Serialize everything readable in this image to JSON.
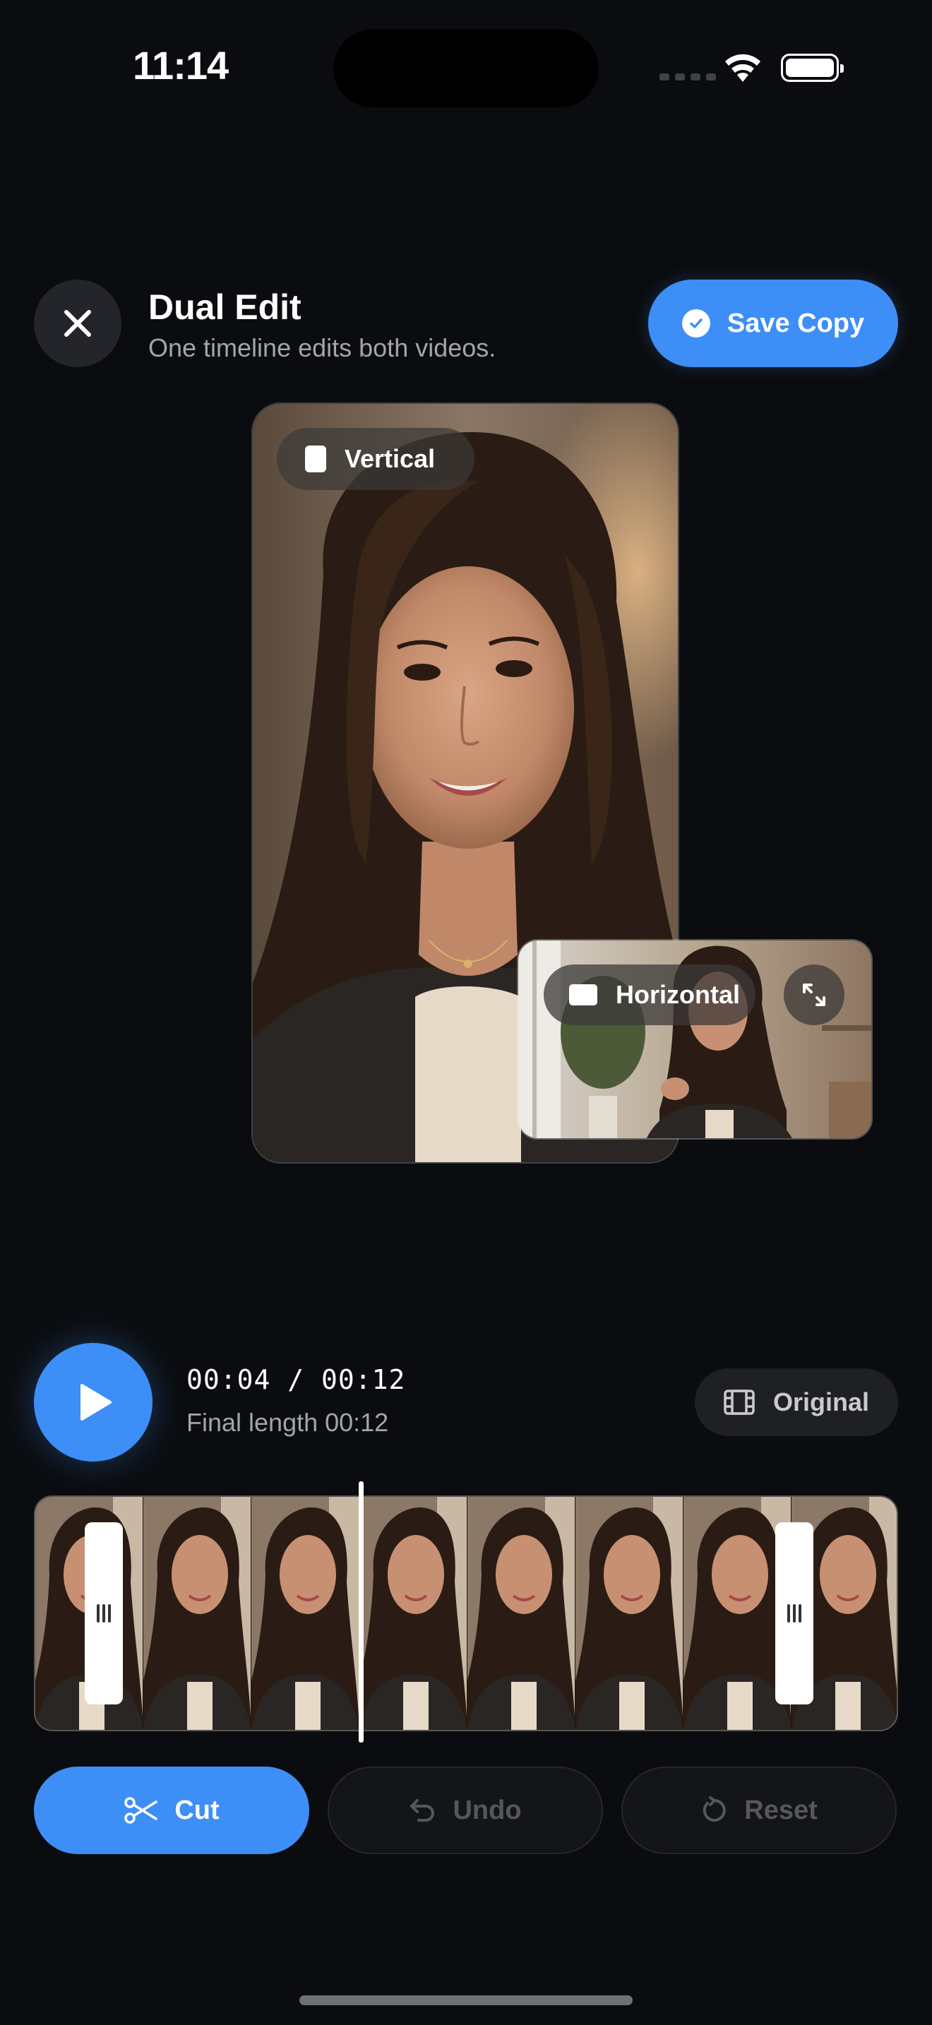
{
  "status_bar": {
    "time": "11:14",
    "icons": [
      "cellular-signal-icon",
      "wifi-icon",
      "battery-icon"
    ]
  },
  "header": {
    "title": "Dual Edit",
    "subtitle": "One timeline edits both videos.",
    "close_icon": "close-icon",
    "save_button": {
      "label": "Save Copy",
      "icon": "check-circle-icon"
    }
  },
  "previews": {
    "vertical": {
      "label": "Vertical",
      "icon": "portrait-shape-icon"
    },
    "horizontal": {
      "label": "Horizontal",
      "icon": "landscape-shape-icon",
      "expand_icon": "expand-icon"
    }
  },
  "playback": {
    "play_icon": "play-icon",
    "current_time": "00:04",
    "total_time": "00:12",
    "time_display": "00:04 / 00:12",
    "final_length": "Final length 00:12",
    "original_button": {
      "label": "Original",
      "icon": "film-icon"
    }
  },
  "timeline": {
    "frame_count": 8,
    "playhead_time": "00:04",
    "handles": [
      "trim-handle-start",
      "trim-handle-end"
    ]
  },
  "actions": {
    "cut": {
      "label": "Cut",
      "icon": "scissors-icon",
      "enabled": true
    },
    "undo": {
      "label": "Undo",
      "icon": "undo-icon",
      "enabled": false
    },
    "reset": {
      "label": "Reset",
      "icon": "reset-icon",
      "enabled": false
    }
  },
  "colors": {
    "background": "#0b0c0f",
    "accent": "#3d8ef7",
    "surface": "#24252a",
    "muted_text": "#a3a5ab",
    "disabled_text": "#55575c"
  }
}
